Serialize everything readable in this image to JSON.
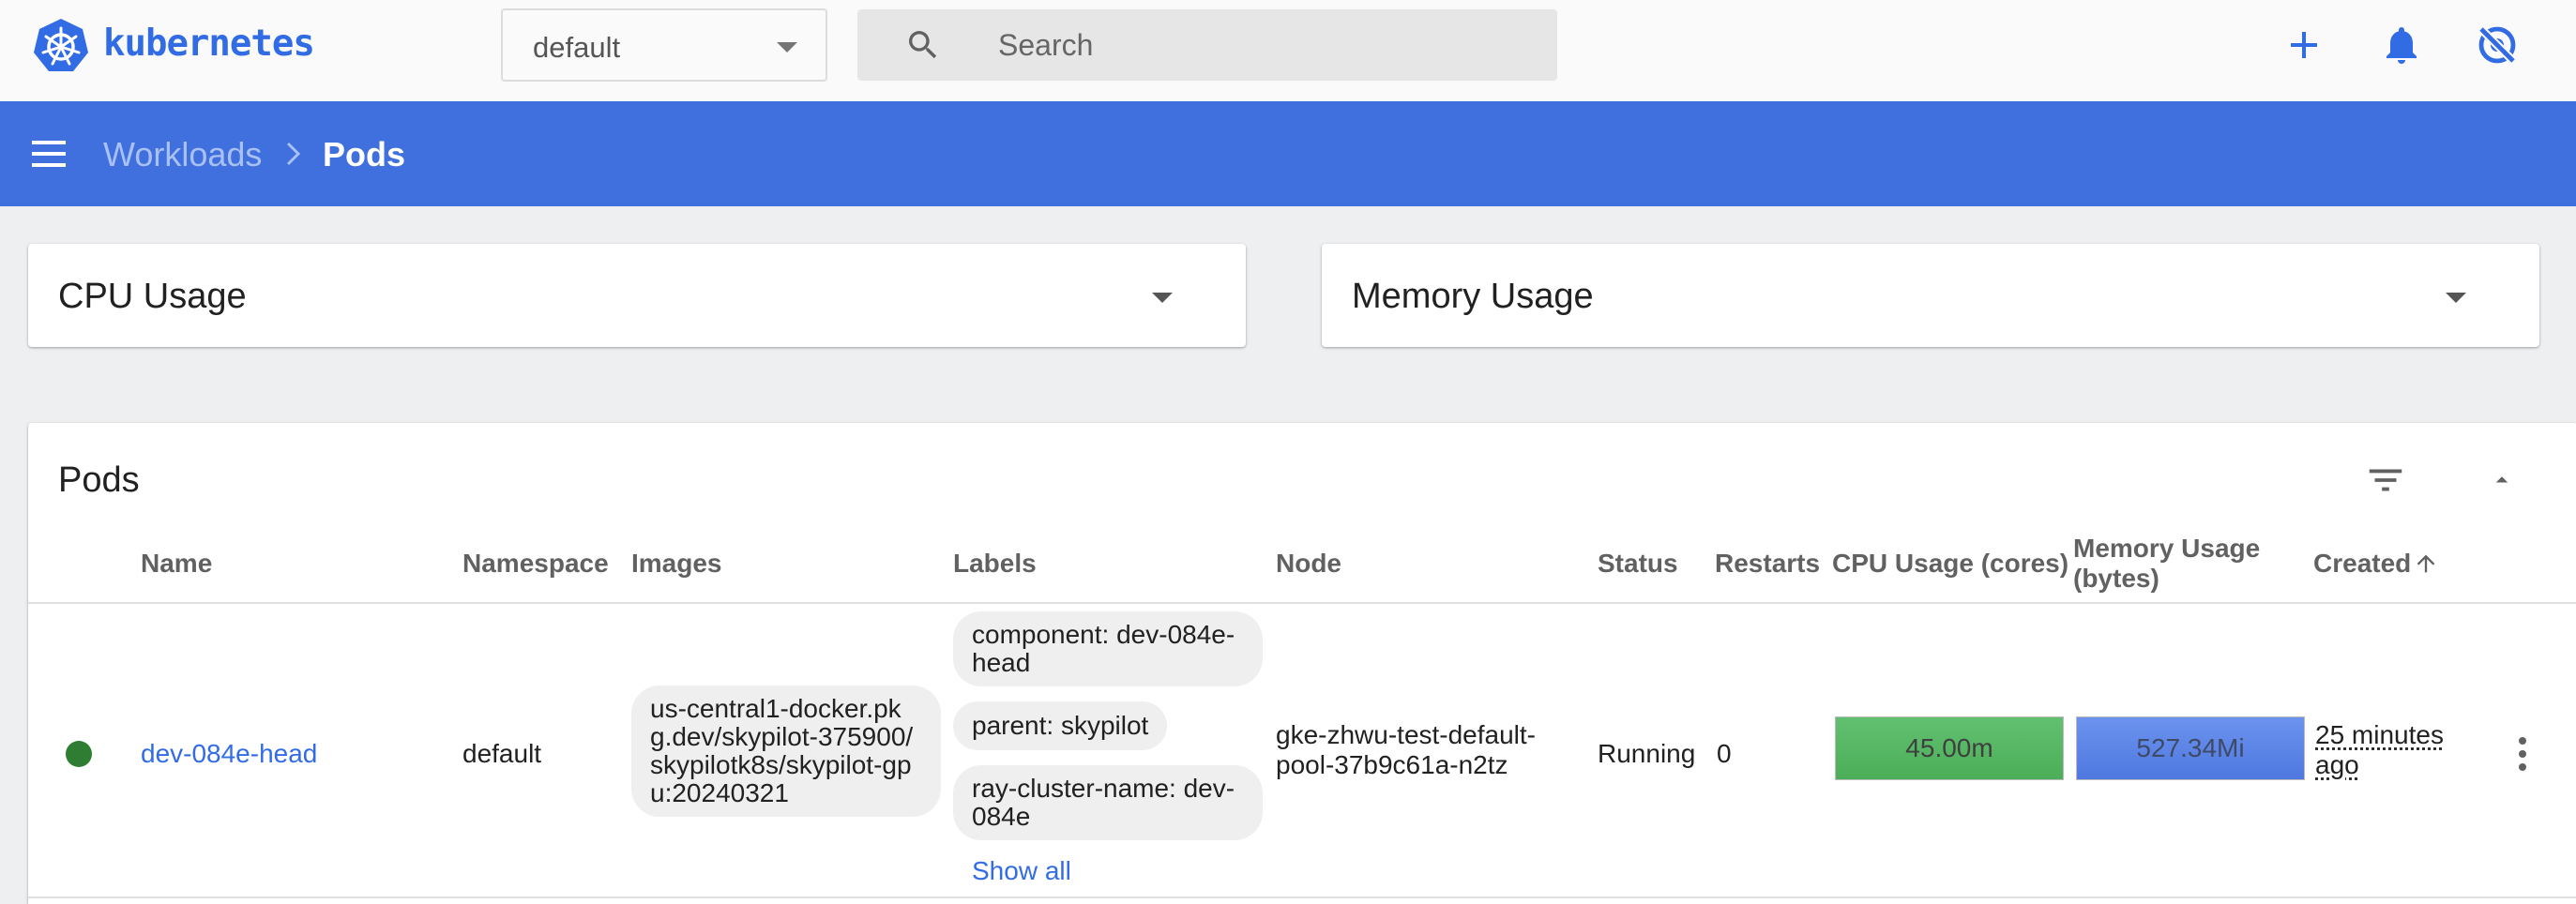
{
  "brand": {
    "name": "kubernetes",
    "accent": "#326ce5"
  },
  "topbar": {
    "namespace_value": "default",
    "search_placeholder": "Search",
    "icons": [
      "plus-icon",
      "bell-icon",
      "settings-off-icon"
    ]
  },
  "breadcrumb": {
    "parent": "Workloads",
    "current": "Pods"
  },
  "panels": {
    "cpu_title": "CPU Usage",
    "memory_title": "Memory Usage"
  },
  "pods": {
    "title": "Pods",
    "columns": [
      "Name",
      "Namespace",
      "Images",
      "Labels",
      "Node",
      "Status",
      "Restarts",
      "CPU Usage (cores)",
      "Memory Usage\n(bytes)",
      "Created"
    ],
    "sort_indicator": "arrow-up-icon",
    "rows": [
      {
        "status_color": "#2e7d32",
        "name": "dev-084e-head",
        "namespace": "default",
        "image": "us-central1-docker.pkg.dev/skypilot-375900/skypilotk8s/skypilot-gpu:20240321",
        "labels": [
          "component: dev-084e-head",
          "parent: skypilot",
          "ray-cluster-name: dev-084e"
        ],
        "labels_more": "Show all",
        "node": "gke-zhwu-test-default-pool-37b9c61a-n2tz",
        "status": "Running",
        "restarts": "0",
        "cpu": "45.00m",
        "memory": "527.34Mi",
        "created": "25 minutes ago"
      }
    ]
  }
}
